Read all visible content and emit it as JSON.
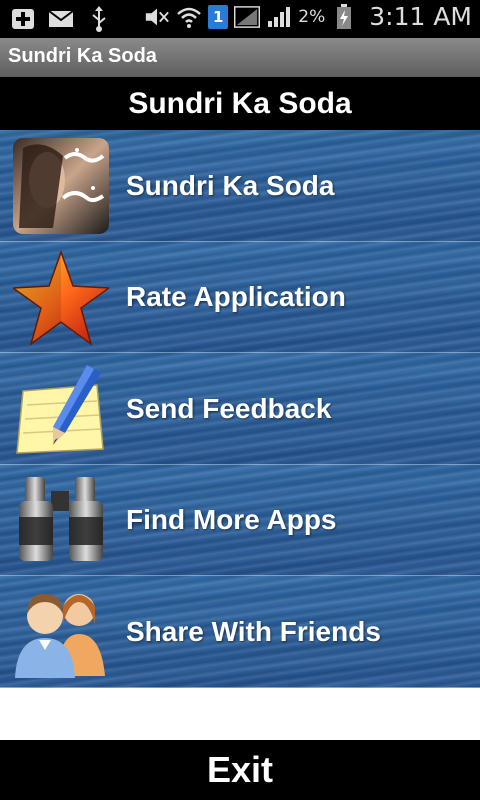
{
  "status_bar": {
    "battery_percent": "2%",
    "clock": "3:11 AM",
    "sim_number": "1",
    "icons": [
      "add-icon",
      "mail-icon",
      "usb-icon",
      "mute-icon",
      "wifi-icon",
      "sim-icon",
      "no-signal-icon",
      "signal-icon",
      "battery-charging-icon"
    ]
  },
  "titlebar": {
    "title": "Sundri Ka Soda"
  },
  "header": {
    "title": "Sundri Ka Soda"
  },
  "menu": {
    "items": [
      {
        "label": "Sundri Ka Soda",
        "icon": "book-cover-icon"
      },
      {
        "label": "Rate Application",
        "icon": "star-icon"
      },
      {
        "label": "Send Feedback",
        "icon": "note-pencil-icon"
      },
      {
        "label": "Find More Apps",
        "icon": "binoculars-icon"
      },
      {
        "label": "Share With Friends",
        "icon": "people-icon"
      }
    ]
  },
  "exit": {
    "label": "Exit"
  },
  "colors": {
    "menu_blue": "#2a5f9c",
    "bar_black": "#000000",
    "titlebar_gray": "#6e6e6e"
  }
}
